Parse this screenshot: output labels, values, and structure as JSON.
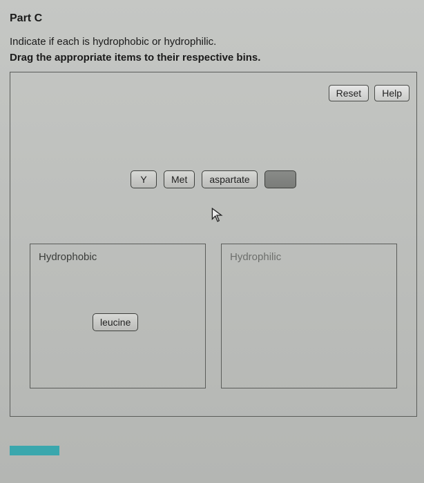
{
  "part_title": "Part C",
  "prompt": "Indicate if each is hydrophobic or hydrophilic.",
  "instruction": "Drag the appropriate items to their respective bins.",
  "buttons": {
    "reset": "Reset",
    "help": "Help"
  },
  "items": {
    "y": "Y",
    "met": "Met",
    "aspartate": "aspartate"
  },
  "bins": {
    "hydrophobic": {
      "title": "Hydrophobic",
      "placed": [
        "leucine"
      ]
    },
    "hydrophilic": {
      "title": "Hydrophilic",
      "placed": []
    }
  },
  "bin_item_leucine": "leucine"
}
